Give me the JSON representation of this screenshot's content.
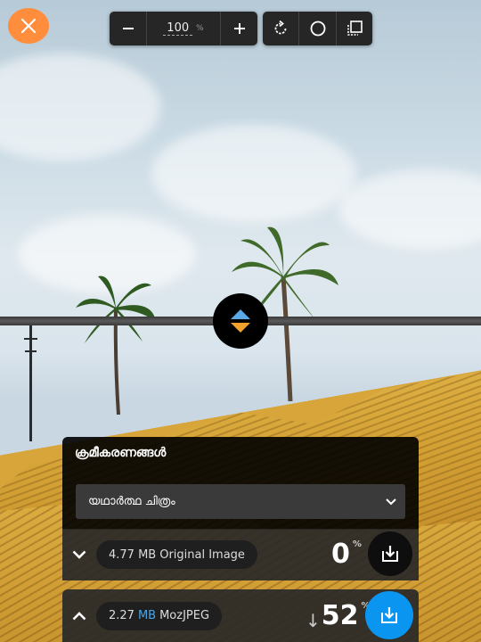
{
  "toolbar": {
    "zoom_value": "100",
    "zoom_unit": "%"
  },
  "settings": {
    "title": "ക്രമീകരണങ്ങൾ",
    "compression_select": "യഥാർത്ഥ ചിത്രം"
  },
  "original": {
    "size": "4.77 MB",
    "label": "Original Image",
    "percent": "0",
    "percent_sign": "%"
  },
  "compressed": {
    "size_number": "2.27",
    "size_unit": "MB",
    "label": "MozJPEG",
    "arrow": "↓",
    "percent": "52",
    "percent_sign": "%"
  },
  "colors": {
    "accent_orange": "#ff8d3b",
    "accent_blue": "#0a96f0",
    "handle_up": "#5aa9e6",
    "handle_down": "#f2a12e"
  },
  "icons": [
    "close-icon",
    "zoom-out-icon",
    "zoom-in-icon",
    "rotate-icon",
    "background-toggle-icon",
    "side-by-side-icon",
    "chevron-down-icon",
    "chevron-up-icon",
    "download-icon"
  ]
}
